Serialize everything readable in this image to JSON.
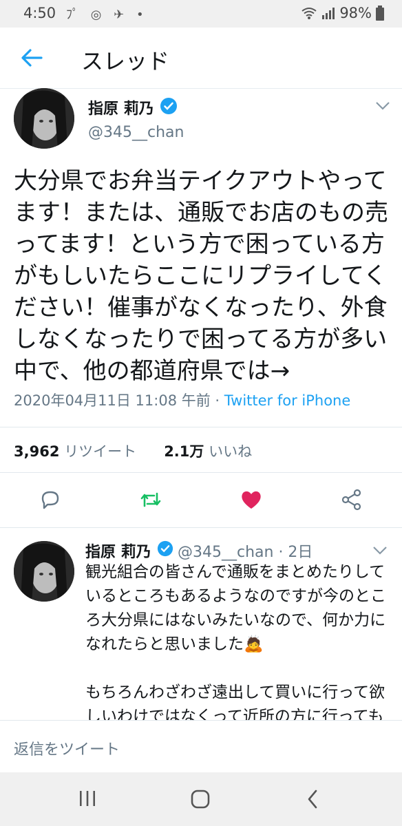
{
  "status_bar": {
    "time": "4:50",
    "notif_icons": "ﾌﾟ ◎ ✈ •",
    "battery": "98%"
  },
  "app_bar": {
    "title": "スレッド"
  },
  "main_tweet": {
    "name": "指原 莉乃",
    "handle": "@345__chan",
    "text": "大分県でお弁当テイクアウトやってます！または、通販でお店のもの売ってます！という方で困っている方がもしいたらここにリプライしてください！催事がなくなったり、外食しなくなったりで困ってる方が多い中で、他の都道府県では→",
    "timestamp": "2020年04月11日 11:08 午前 · ",
    "source": "Twitter for iPhone",
    "retweet_count": "3,962",
    "retweet_label": "リツイート",
    "like_count": "2.1万",
    "like_label": "いいね",
    "liked_color": "#e0245e",
    "retweeted_color": "#17bf63"
  },
  "reply_tweet": {
    "name": "指原 莉乃",
    "handle_time": "@345__chan · 2日",
    "paragraph1": "観光組合の皆さんで通販をまとめたりしているところもあるようなのですが今のところ大分県にはないみたいなので、何か力になれたらと思いました🙇",
    "paragraph2": "もちろんわざわざ遠出して買いに行って欲しいわけではなくって近所の方に行ってもらえたら、という感覚です"
  },
  "composer": {
    "placeholder": "返信をツイート"
  },
  "icons": [
    "back-arrow-icon",
    "verified-icon",
    "chevron-down-icon",
    "reply-icon",
    "retweet-icon",
    "heart-icon",
    "share-icon",
    "wifi-icon",
    "signal-icon",
    "battery-icon",
    "recent-apps-icon",
    "home-icon",
    "back-nav-icon"
  ]
}
